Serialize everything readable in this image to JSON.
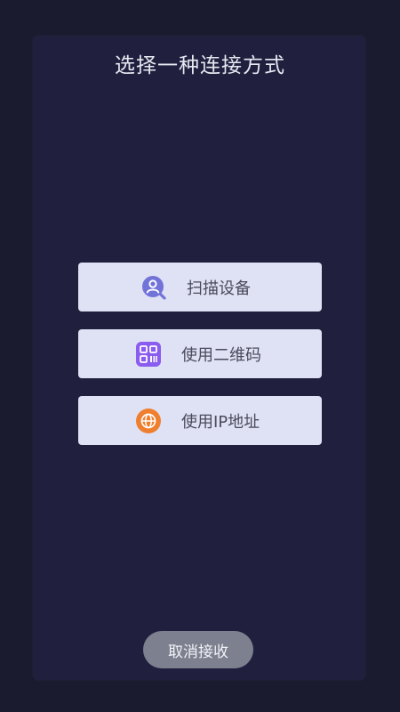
{
  "dialog": {
    "title": "选择一种连接方式"
  },
  "options": [
    {
      "label": "扫描设备",
      "icon": "scan-device-icon",
      "icon_color": "#7173d9"
    },
    {
      "label": "使用二维码",
      "icon": "qr-code-icon",
      "icon_color": "#8b5cf0"
    },
    {
      "label": "使用IP地址",
      "icon": "globe-icon",
      "icon_color": "#ef7f2f"
    }
  ],
  "cancel": {
    "label": "取消接收"
  },
  "colors": {
    "background": "#1a1b2f",
    "dialog": "#20203e",
    "option_bg": "#dfe1f4",
    "cancel_bg": "#7d808f"
  }
}
